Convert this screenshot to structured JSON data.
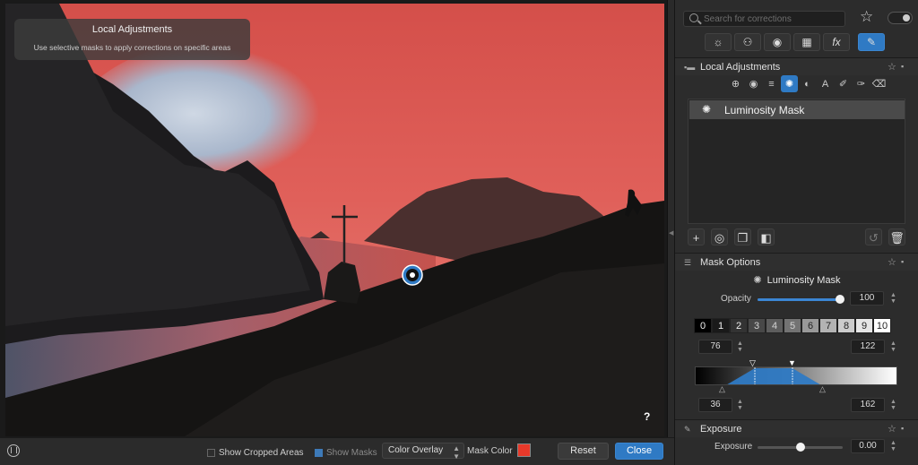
{
  "viewer": {
    "tip_title": "Local Adjustments",
    "tip_text": "Use selective masks to apply corrections on specific areas",
    "help": "?"
  },
  "bottombar": {
    "show_cropped": "Show Cropped Areas",
    "show_masks": "Show Masks",
    "overlay_mode": "Color Overlay",
    "mask_color_label": "Mask Color",
    "mask_color": "#e8392a",
    "reset": "Reset",
    "close": "Close"
  },
  "panel": {
    "search_placeholder": "Search for corrections",
    "local_adjustments": {
      "title": "Local Adjustments",
      "mask_item": "Luminosity Mask"
    },
    "mask_options": {
      "title": "Mask Options",
      "mask_name": "Luminosity Mask",
      "opacity_label": "Opacity",
      "opacity_value": "100",
      "opacity_fraction": 1.0,
      "zones": [
        "0",
        "1",
        "2",
        "3",
        "4",
        "5",
        "6",
        "7",
        "8",
        "9",
        "10"
      ],
      "inner_low": "76",
      "inner_high": "122",
      "outer_low": "36",
      "outer_high": "162"
    },
    "exposure": {
      "title": "Exposure",
      "label": "Exposure",
      "value": "0.00",
      "fraction": 0.5
    }
  },
  "colors": {
    "accent": "#2f7ac4",
    "sky_mask": "#d9554f"
  }
}
